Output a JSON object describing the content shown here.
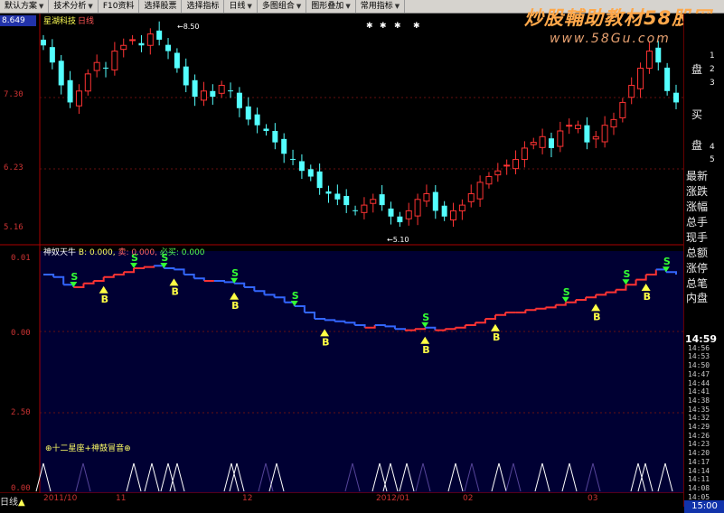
{
  "toolbar": {
    "items": [
      {
        "label": "默认方案"
      },
      {
        "label": "技术分析"
      },
      {
        "label": "F10资料"
      },
      {
        "label": "选择股票"
      },
      {
        "label": "选择指标"
      },
      {
        "label": "日线"
      },
      {
        "label": "多图组合"
      },
      {
        "label": "图形叠加"
      },
      {
        "label": "常用指标"
      }
    ]
  },
  "watermark": {
    "line1": "炒股輔助教材58股网",
    "line2": "www.58Gu.com"
  },
  "stock": {
    "name": "星湖科技",
    "period": "日线",
    "price_top": "8.649",
    "hi_label": "8.50",
    "lo_label": "5.10"
  },
  "price_axis": [
    "7.30",
    "6.23",
    "5.16"
  ],
  "indicator": {
    "name": "神奴天牛",
    "v1": "B: 0.000,",
    "v2": "卖: 0.000,",
    "v3": "必买: 0.000",
    "note": "⊕十二星座+神鼓冒音⊕"
  },
  "ind_axis": [
    "0.01",
    "0.00",
    "2.50",
    "0.00"
  ],
  "right_panel": {
    "side_chars": [
      "盘",
      "买",
      "盘"
    ],
    "side_nums": [
      "1",
      "2",
      "3",
      "4",
      "5"
    ],
    "items": [
      "最新",
      "涨跌",
      "涨幅",
      "总手",
      "现手",
      "总额",
      "涨停",
      "总笔",
      "内盘"
    ],
    "times": [
      "14:59",
      "14:56",
      "14:53",
      "14:50",
      "14:47",
      "14:44",
      "14:41",
      "14:38",
      "14:35",
      "14:32",
      "14:29",
      "14:26",
      "14:23",
      "14:20",
      "14:17",
      "14:14",
      "14:11",
      "14:08",
      "14:05"
    ],
    "current_time": "14:59",
    "end_time": "15:00"
  },
  "bottom": {
    "period": "日线",
    "dates": [
      "2011/10",
      "11",
      "12",
      "2012/01",
      "02",
      "03"
    ]
  },
  "chart_data": {
    "type": "candlestick",
    "ylim": [
      4.9,
      8.7
    ],
    "y_ticks": [
      7.3,
      6.23,
      5.16
    ],
    "closes": [
      8.3,
      8.0,
      7.6,
      7.3,
      7.5,
      7.8,
      8.0,
      7.9,
      8.2,
      8.3,
      8.4,
      8.3,
      8.5,
      8.4,
      8.2,
      7.9,
      7.6,
      7.4,
      7.5,
      7.4,
      7.6,
      7.5,
      7.2,
      7.0,
      6.9,
      6.8,
      6.6,
      6.4,
      6.3,
      6.1,
      6.0,
      5.8,
      5.7,
      5.6,
      5.5,
      5.4,
      5.5,
      5.6,
      5.5,
      5.3,
      5.2,
      5.4,
      5.6,
      5.7,
      5.4,
      5.3,
      5.4,
      5.5,
      5.7,
      5.9,
      6.0,
      6.1,
      6.2,
      6.3,
      6.5,
      6.6,
      6.7,
      6.5,
      6.8,
      6.9,
      6.9,
      6.6,
      6.7,
      6.9,
      7.0,
      7.3,
      7.6,
      7.9,
      8.2,
      8.0,
      7.5,
      7.3
    ],
    "indicator_line": [
      0.9,
      0.88,
      0.82,
      0.8,
      0.83,
      0.85,
      0.88,
      0.9,
      0.92,
      0.95,
      0.96,
      0.97,
      0.95,
      0.94,
      0.9,
      0.87,
      0.85,
      0.85,
      0.84,
      0.83,
      0.8,
      0.77,
      0.74,
      0.72,
      0.68,
      0.65,
      0.6,
      0.55,
      0.54,
      0.53,
      0.52,
      0.5,
      0.48,
      0.5,
      0.49,
      0.47,
      0.46,
      0.47,
      0.48,
      0.46,
      0.47,
      0.48,
      0.5,
      0.52,
      0.55,
      0.58,
      0.6,
      0.6,
      0.62,
      0.63,
      0.64,
      0.66,
      0.68,
      0.7,
      0.72,
      0.74,
      0.76,
      0.78,
      0.82,
      0.86,
      0.9,
      0.94,
      0.92,
      0.9
    ]
  }
}
